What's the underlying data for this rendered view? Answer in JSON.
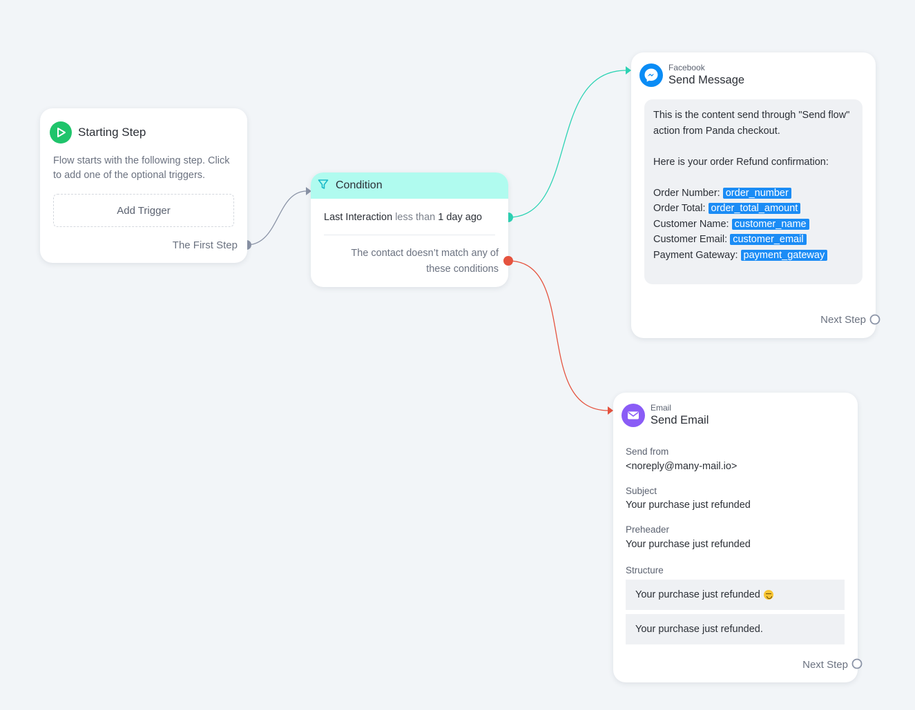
{
  "starting_step": {
    "title": "Starting Step",
    "description": "Flow starts with the following step. Click to add one of the optional triggers.",
    "add_trigger_label": "Add Trigger",
    "output_label": "The First Step"
  },
  "condition": {
    "title": "Condition",
    "rule": {
      "field": "Last Interaction",
      "operator": "less than",
      "value": "1 day ago"
    },
    "else_label": "The contact doesn’t match any of these conditions"
  },
  "facebook": {
    "channel": "Facebook",
    "action": "Send Message",
    "message_intro": "This is the content send through \"Send flow\" action from Panda checkout.",
    "message_line": "Here is your order Refund confirmation:",
    "fields": [
      {
        "label": "Order Number:",
        "tag": "order_number"
      },
      {
        "label": "Order Total:",
        "tag": "order_total_amount"
      },
      {
        "label": "Customer Name:",
        "tag": "customer_name"
      },
      {
        "label": "Customer Email:",
        "tag": "customer_email"
      },
      {
        "label": "Payment Gateway:",
        "tag": "payment_gateway"
      }
    ],
    "next_label": "Next Step"
  },
  "email": {
    "channel": "Email",
    "action": "Send Email",
    "send_from_label": "Send from",
    "send_from_value": "<noreply@many-mail.io>",
    "subject_label": "Subject",
    "subject_value": "Your purchase just refunded",
    "preheader_label": "Preheader",
    "preheader_value": "Your purchase just refunded",
    "structure_label": "Structure",
    "structure": [
      "Your purchase just refunded",
      "Your purchase just refunded."
    ],
    "next_label": "Next Step"
  },
  "colors": {
    "start_green": "#1fc46b",
    "condition_header": "#b0fbef",
    "match_connector": "#2dd3b4",
    "nomatch_connector": "#e5533f",
    "default_connector": "#8a93a6",
    "messenger_blue": "#0a8cf5",
    "email_purple": "#8a5cf6",
    "tag_blue": "#1b8cf5"
  },
  "icons": {
    "start": "play-icon",
    "condition": "filter-icon",
    "facebook": "messenger-icon",
    "email": "envelope-icon"
  }
}
